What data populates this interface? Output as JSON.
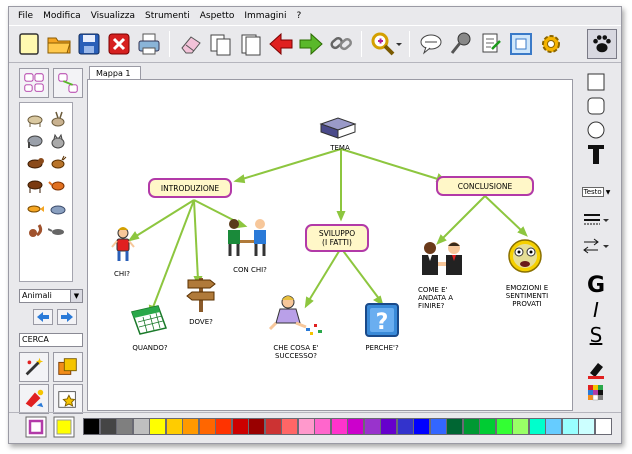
{
  "menu": [
    "File",
    "Modifica",
    "Visualizza",
    "Strumenti",
    "Aspetto",
    "Immagini",
    "?"
  ],
  "tab_label": "Mappa 1",
  "category": "Animali",
  "search_value": "CERCA",
  "map": {
    "root": "TEMA",
    "introduzione": "INTRODUZIONE",
    "sviluppo": "SVILUPPO\n(I FATTI)",
    "conclusione": "CONCLUSIONE",
    "chi": "CHI?",
    "quando": "QUANDO?",
    "dove": "DOVE?",
    "con_chi": "CON CHI?",
    "che_cosa": "CHE COSA E'\nSUCCESSO?",
    "perche": "PERCHE'?",
    "come": "COME E'\nANDATA A\nFINIRE?",
    "emozioni": "EMOZIONI E\nSENTIMENTI\nPROVATI"
  },
  "right_tools": {
    "text_style": "Testo",
    "bold": "G",
    "italic": "I",
    "underline": "S"
  },
  "palette": [
    "#000000",
    "#454545",
    "#7f7f7f",
    "#bfbfbf",
    "#ffff00",
    "#ffcc00",
    "#ff9900",
    "#ff6600",
    "#ff3300",
    "#cc0000",
    "#990000",
    "#cc3333",
    "#ff6666",
    "#ff99cc",
    "#ff66cc",
    "#ff33cc",
    "#cc00cc",
    "#9933cc",
    "#6600cc",
    "#3333cc",
    "#0000ff",
    "#3366ff",
    "#006633",
    "#009933",
    "#00cc33",
    "#33ff33",
    "#99ff66",
    "#00ffcc",
    "#66ccff",
    "#99ffff",
    "#ccffff",
    "#ffffff"
  ],
  "colors": {
    "node_border": "#b23aa8",
    "node_fill": "#fff7c8",
    "link": "#8dc63f",
    "selected_fill": "#ffff00",
    "selected_stroke": "#b23aa8"
  }
}
